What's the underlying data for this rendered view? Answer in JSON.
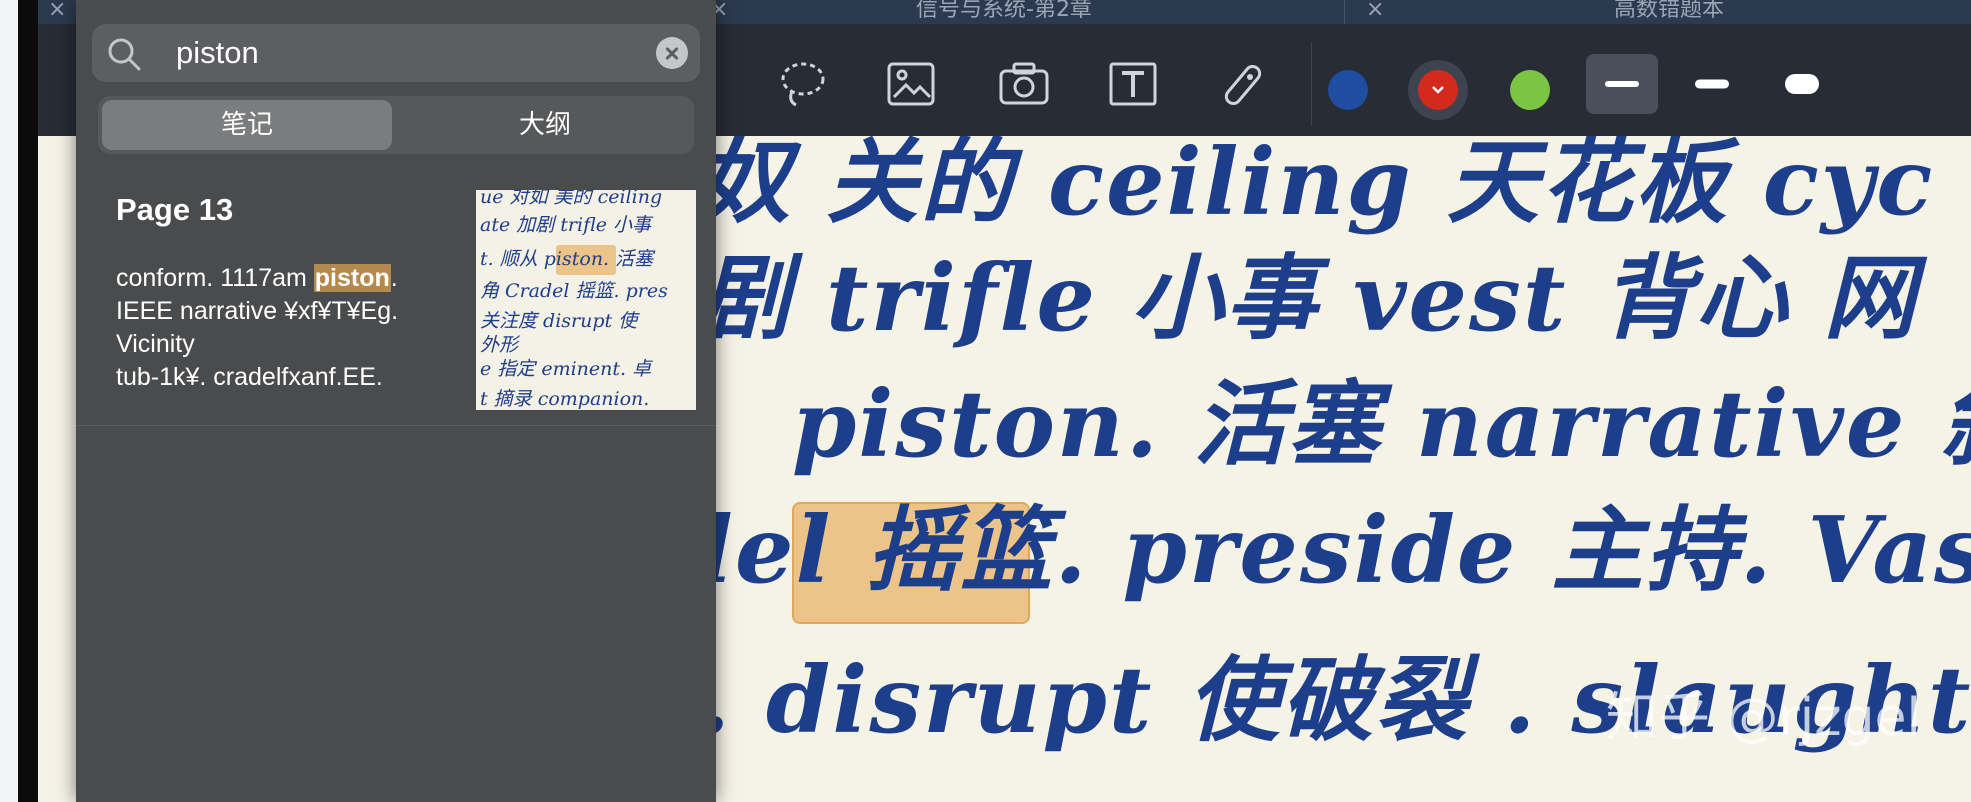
{
  "tabs": [
    {
      "label": ""
    },
    {
      "label": "信号与系统-第2章"
    },
    {
      "label": "高数错题本"
    }
  ],
  "toolbar": {
    "tools": [
      "lasso-icon",
      "image-icon",
      "camera-icon",
      "text-box-icon",
      "laser-pointer-icon"
    ],
    "colors": [
      "#1e4da1",
      "#d42a1e",
      "#7cc443"
    ],
    "selected_color_index": 1,
    "thickness_selected_index": 0
  },
  "search": {
    "value": "piston",
    "placeholder": ""
  },
  "segments": {
    "notes": "笔记",
    "outline": "大纲"
  },
  "result": {
    "title": "Page 13",
    "snippet_line1_pre": "conform. 1117am ",
    "snippet_highlight": "piston",
    "snippet_line1_post": ".",
    "snippet_line2": "IEEE narrative ¥xf¥T¥Eg.",
    "snippet_line3": "Vicinity",
    "snippet_line4": "tub-1k¥. cradelfxanf.EE."
  },
  "thumbnail": {
    "lines": [
      "ue 对如 美的 ceiling",
      "ate 加剧 trifle 小事",
      "t. 顺从 piston. 活塞",
      "角 Cradel 摇篮. pres",
      "关注度 disrupt 使",
      "外形",
      "e 指定 eminent. 卓",
      "t 摘录 companion."
    ]
  },
  "canvas": {
    "rows": [
      "奴 关的 ceiling 天花板 cyc",
      "剧 trifle 小事 vest 背心 网",
      "piston. 活塞 narrative 叙事",
      "lel 摇篮. preside 主持. Vast",
      ". disrupt 使破裂 . slaughte"
    ],
    "watermark": "知乎 @rjzgel"
  }
}
